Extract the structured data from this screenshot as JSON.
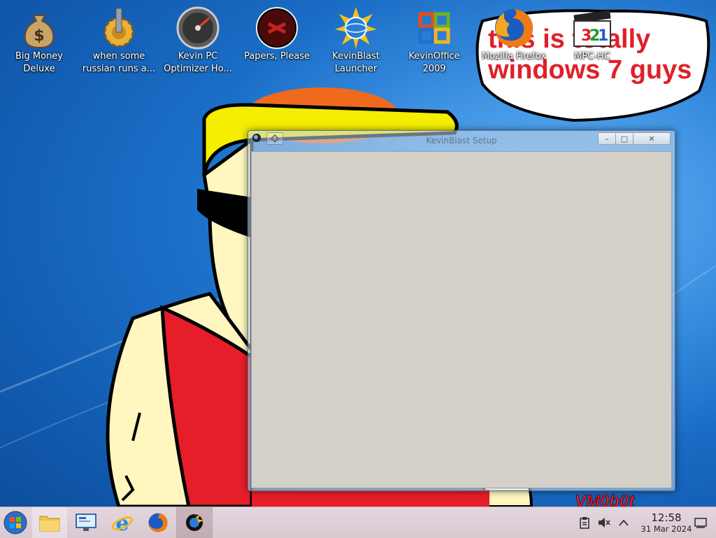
{
  "desktop": {
    "icons": [
      {
        "label": "Big Money\nDeluxe",
        "icon": "money-bag-icon"
      },
      {
        "label": "when some\nrussian runs a...",
        "icon": "gear-icon"
      },
      {
        "label": "Kevin PC\nOptimizer Ho...",
        "icon": "speedometer-icon"
      },
      {
        "label": "Papers, Please",
        "icon": "papers-please-icon"
      },
      {
        "label": "KevinBlast\nLauncher",
        "icon": "sun-globe-icon"
      },
      {
        "label": "KevinOffice\n2009",
        "icon": "office-icon"
      },
      {
        "label": "Mozilla Firefox",
        "icon": "firefox-icon"
      },
      {
        "label": "MPC-HC",
        "icon": "mpc-hc-icon"
      }
    ],
    "speech_bubble_line1": "this is totally",
    "speech_bubble_line2": "windows 7 guys",
    "signature": "VM0b0t"
  },
  "window": {
    "title": "KevinBlast Setup",
    "controls": {
      "minimize": "–",
      "maximize": "□",
      "close": "✕"
    }
  },
  "taskbar": {
    "pinned": [
      "start-orb-icon",
      "file-explorer-icon",
      "remote-desktop-icon",
      "internet-explorer-icon",
      "firefox-icon",
      "kevinblast-icon"
    ],
    "tray": {
      "time": "12:58",
      "date": "31 Mar 2024"
    }
  },
  "colors": {
    "wallpaper_blue": "#1f78d2",
    "window_client": "#d4d0c8",
    "taskbar": "#dccdd5",
    "bubble_text": "#e0202a",
    "shirt_red": "#e61e2a",
    "hat_yellow": "#f5ee00"
  }
}
